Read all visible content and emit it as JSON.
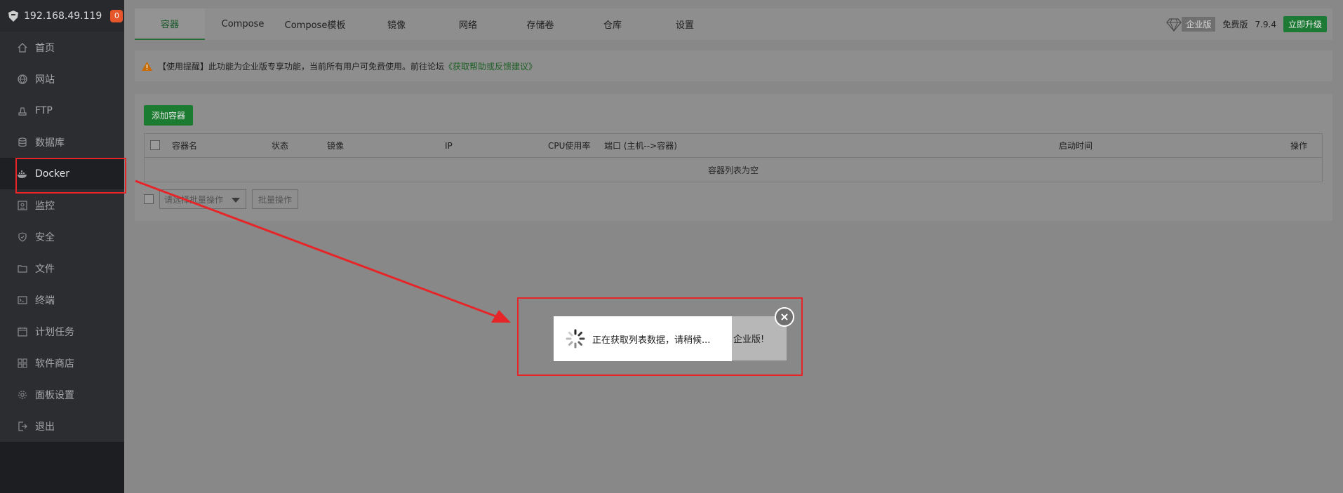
{
  "sidebar": {
    "host": "192.168.49.119",
    "badge": "0",
    "items": [
      {
        "label": "首页",
        "icon": "home-icon"
      },
      {
        "label": "网站",
        "icon": "globe-icon"
      },
      {
        "label": "FTP",
        "icon": "ftp-icon"
      },
      {
        "label": "数据库",
        "icon": "database-icon"
      },
      {
        "label": "Docker",
        "icon": "docker-icon"
      },
      {
        "label": "监控",
        "icon": "monitor-icon"
      },
      {
        "label": "安全",
        "icon": "shield-icon"
      },
      {
        "label": "文件",
        "icon": "folder-icon"
      },
      {
        "label": "终端",
        "icon": "terminal-icon"
      },
      {
        "label": "计划任务",
        "icon": "calendar-icon"
      },
      {
        "label": "软件商店",
        "icon": "apps-icon"
      },
      {
        "label": "面板设置",
        "icon": "gear-icon"
      },
      {
        "label": "退出",
        "icon": "logout-icon"
      }
    ]
  },
  "tabs": [
    "容器",
    "Compose",
    "Compose模板",
    "镜像",
    "网络",
    "存储卷",
    "仓库",
    "设置"
  ],
  "nav_right": {
    "enterprise": "企业版",
    "free": "免费版",
    "version": "7.9.4",
    "upgrade": "立即升级"
  },
  "notice": {
    "text": "【使用提醒】此功能为企业版专享功能，当前所有用户可免费使用。前往论坛",
    "link": "《获取帮助或反馈建议》"
  },
  "add_button": "添加容器",
  "table": {
    "headers": [
      "容器名",
      "状态",
      "镜像",
      "IP",
      "CPU使用率",
      "端口 (主机-->容器)",
      "启动时间",
      "操作"
    ],
    "empty": "容器列表为空"
  },
  "batch": {
    "select_placeholder": "请选择批量操作",
    "button": "批量操作"
  },
  "loading": {
    "text": "正在获取列表数据，请稍候...",
    "behind": "企业版!"
  },
  "colors": {
    "accent": "#1a7b31",
    "annotation": "#e52528"
  }
}
